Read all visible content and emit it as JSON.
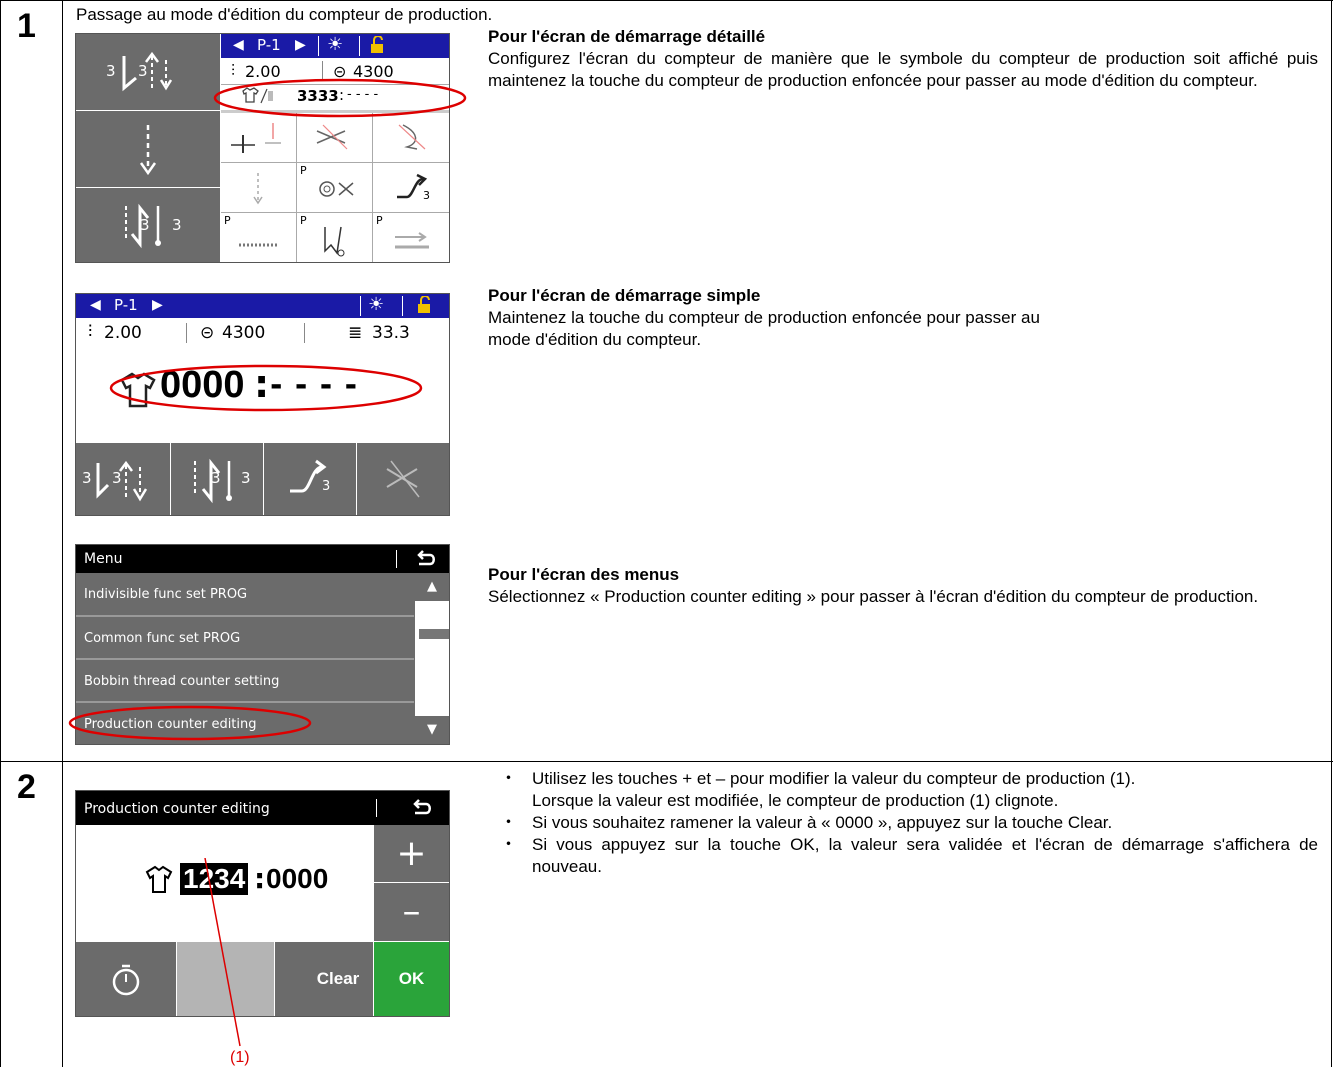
{
  "step1": {
    "number": "1",
    "intro": "Passage au mode d'édition du compteur de production.",
    "detailed": {
      "heading": "Pour l'écran de démarrage détaillé",
      "text": "Configurez l'écran du compteur de manière que le symbole du compteur de production soit affiché puis maintenez la touche du compteur de production enfoncée pour passer au mode d'édition du compteur.",
      "screen": {
        "left_btn_top_left": "3",
        "left_btn_top_right": "3",
        "left_btn_bottom_left": "3",
        "left_btn_bottom_right": "3",
        "pattern": "P-1",
        "pitch": "2.00",
        "speed": "4300",
        "counter": "3333",
        "counter_suffix": "- - - -",
        "cell_sub_3": "3",
        "cell_p": "P"
      }
    },
    "simple": {
      "heading": "Pour l'écran de démarrage simple",
      "text": "Maintenez la touche du compteur de production enfoncée pour passer au mode d'édition du compteur.",
      "screen": {
        "pattern": "P-1",
        "pitch": "2.00",
        "speed": "4300",
        "bobbin": "33.3",
        "counter": "0000",
        "counter_suffix": "- - - -",
        "btn1_left": "3",
        "btn1_right": "3",
        "btn2_left": "3",
        "btn2_right": "3",
        "btn3_sub": "3"
      }
    },
    "menu": {
      "heading": "Pour l'écran des menus",
      "text": "Sélectionnez « Production counter editing » pour passer à l'écran d'édition du compteur de production.",
      "screen": {
        "title": "Menu",
        "items": [
          "Indivisible func set PROG",
          "Common func set PROG",
          "Bobbin thread counter setting",
          "Production counter editing"
        ]
      }
    }
  },
  "step2": {
    "number": "2",
    "screen": {
      "title": "Production counter editing",
      "value": "1234",
      "value_suffix": "0000",
      "plus": "+",
      "minus": "–",
      "clear": "Clear",
      "ok": "OK"
    },
    "callout": "(1)",
    "bullets": [
      "Utilisez les touches + et – pour modifier la valeur du compteur de production (1).",
      "Si vous souhaitez ramener la valeur à « 0000 », appuyez sur la touche Clear.",
      "Si vous appuyez sur la touche OK, la valeur sera validée et l'écran de démarrage s'affichera de nouveau."
    ],
    "bullet1_continuation": "Lorsque la valeur est modifiée, le compteur de production (1) clignote.",
    "bullet_marker": "・"
  },
  "colors": {
    "header_blue": "#1a1aa6",
    "highlight_red": "#dd0000",
    "ok_green": "#2aa43a",
    "screen_gray": "#6b6b6b",
    "lock_yellow": "#f0c000"
  }
}
